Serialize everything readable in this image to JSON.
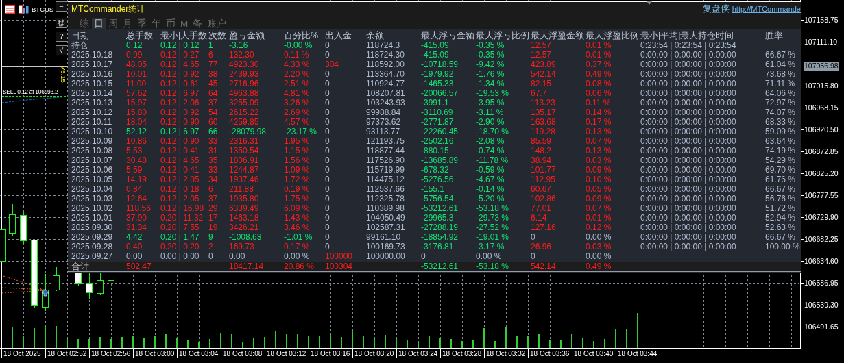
{
  "symbol": "BTCUS",
  "side_buttons": [
    "−",
    "移",
    "?",
    "√"
  ],
  "version": "V5.15",
  "order_label": "SELL 0.12 at 106993.2",
  "panel": {
    "title": "MTCommander统计",
    "brand": "复盘侠",
    "link": "http://MTCommande",
    "tabs": [
      {
        "label": "综",
        "selected": false
      },
      {
        "label": "日",
        "selected": true
      },
      {
        "label": "周",
        "selected": false
      },
      {
        "label": "月",
        "selected": false
      },
      {
        "label": "季",
        "selected": false
      },
      {
        "label": "年",
        "selected": false
      },
      {
        "label": "币",
        "selected": false
      },
      {
        "label": "M",
        "selected": false
      },
      {
        "label": "备",
        "selected": false
      },
      {
        "label": "账户",
        "selected": false
      }
    ],
    "columns": [
      {
        "title": "日期",
        "kind": "date"
      },
      {
        "title": "总手数",
        "kind": "result"
      },
      {
        "title": "最小|大手数",
        "kind": "result"
      },
      {
        "title": "次数",
        "kind": "result"
      },
      {
        "title": "盈亏金额",
        "kind": "result"
      },
      {
        "title": "百分比%",
        "kind": "result"
      },
      {
        "title": "出入金",
        "kind": "deposit"
      },
      {
        "title": "余额",
        "kind": "neutral"
      },
      {
        "title": "最大浮亏金额",
        "kind": "loss"
      },
      {
        "title": "最大浮亏比例",
        "kind": "loss"
      },
      {
        "title": "最大浮盈金额",
        "kind": "gain"
      },
      {
        "title": "最大浮盈比例",
        "kind": "gain"
      },
      {
        "title": "最小|平均|最大持仓时间",
        "kind": "neutral"
      },
      {
        "title": "胜率",
        "kind": "neutral"
      }
    ],
    "rows": [
      {
        "kind": "loss",
        "cells": [
          "持仓",
          "0.12",
          "0.12 | 0.12",
          "1",
          "-3.16",
          "-0.00 %",
          "0",
          "118724.3",
          "-415.09",
          "-0.35 %",
          "12.57",
          "0.01 %",
          "0:23:54 | 0:23:54 | 0:23:54",
          null
        ]
      },
      {
        "kind": "profit",
        "cells": [
          "2025.10.18",
          "0.99",
          "0.12 | 0.27",
          "6",
          "132.30",
          "0.11 %",
          "0",
          "118724.30",
          "-415.09",
          "-0.35 %",
          "12.57",
          "0.01 %",
          "0:00:00 | 0:00:00 | 0:00:00",
          "66.67 %"
        ]
      },
      {
        "kind": "profit",
        "cells": [
          "2025.10.17",
          "48.05",
          "0.12 | 4.65",
          "77",
          "4923.30",
          "4.33 %",
          "304",
          "118592.00",
          "-10718.59",
          "-9.42 %",
          "423.89",
          "0.37 %",
          "0:00:00 | 0:00:00 | 0:00:00",
          "61.04 %"
        ]
      },
      {
        "kind": "profit",
        "cells": [
          "2025.10.16",
          "10.01",
          "0.12 | 0.92",
          "38",
          "2439.93",
          "2.20 %",
          "0",
          "113364.70",
          "-1979.92",
          "-1.76 %",
          "542.14",
          "0.49 %",
          "0:00:00 | 0:00:00 | 0:00:00",
          "73.68 %"
        ]
      },
      {
        "kind": "profit",
        "cells": [
          "2025.10.15",
          "11.00",
          "0.12 | 0.61",
          "45",
          "2716.96",
          "2.51 %",
          "0",
          "110924.77",
          "-1465.33",
          "-1.34 %",
          "82.15",
          "0.08 %",
          "0:00:00 | 0:00:00 | 0:00:00",
          "71.11 %"
        ]
      },
      {
        "kind": "profit",
        "cells": [
          "2025.10.14",
          "57.62",
          "0.12 | 6.97",
          "64",
          "4963.88",
          "4.81 %",
          "0",
          "108207.81",
          "-20066.57",
          "-19.53 %",
          "67.7",
          "0.06 %",
          "0:00:00 | 0:00:00 | 0:00:00",
          "64.06 %"
        ]
      },
      {
        "kind": "profit",
        "cells": [
          "2025.10.13",
          "15.97",
          "0.12 | 2.06",
          "37",
          "3255.09",
          "3.26 %",
          "0",
          "103243.93",
          "-3991.1",
          "-3.95 %",
          "113.23",
          "0.11 %",
          "0:00:00 | 0:00:00 | 0:00:00",
          "72.97 %"
        ]
      },
      {
        "kind": "profit",
        "cells": [
          "2025.10.12",
          "15.80",
          "0.12 | 0.92",
          "54",
          "2615.22",
          "2.69 %",
          "0",
          "99988.84",
          "-3110.69",
          "-3.11 %",
          "135.17",
          "0.14 %",
          "0:00:00 | 0:00:00 | 0:00:00",
          "74.07 %"
        ]
      },
      {
        "kind": "profit",
        "cells": [
          "2025.10.11",
          "18.04",
          "0.12 | 0.90",
          "60",
          "4259.85",
          "4.57 %",
          "0",
          "97373.62",
          "-2771.87",
          "-2.90 %",
          "163.68",
          "0.17 %",
          "0:00:00 | 0:00:00 | 0:00:00",
          "68.33 %"
        ]
      },
      {
        "kind": "loss",
        "cells": [
          "2025.10.10",
          "52.12",
          "0.12 | 6.97",
          "66",
          "-28079.98",
          "-23.17 %",
          "0",
          "93113.77",
          "-22260.45",
          "-18.70 %",
          "119.28",
          "0.13 %",
          "0:00:00 | 0:00:00 | 0:00:00",
          "59.09 %"
        ]
      },
      {
        "kind": "profit",
        "cells": [
          "2025.10.09",
          "10.86",
          "0.12 | 0.90",
          "33",
          "2316.31",
          "1.95 %",
          "0",
          "121193.75",
          "-2502.16",
          "-2.08 %",
          "85.59",
          "0.07 %",
          "0:00:00 | 0:00:00 | 0:00:00",
          "63.64 %"
        ]
      },
      {
        "kind": "profit",
        "cells": [
          "2025.10.08",
          "5.53",
          "0.12 | 0.41",
          "31",
          "1350.54",
          "1.15 %",
          "0",
          "118877.44",
          "-880.15",
          "-0.74 %",
          "148.2",
          "0.13 %",
          "0:00:00 | 0:00:00 | 0:00:00",
          "74.19 %"
        ]
      },
      {
        "kind": "profit",
        "cells": [
          "2025.10.07",
          "30.48",
          "0.12 | 4.65",
          "35",
          "1806.91",
          "1.56 %",
          "0",
          "117526.90",
          "-13685.89",
          "-11.78 %",
          "38.94",
          "0.03 %",
          "0:00:00 | 0:00:00 | 0:00:00",
          "54.29 %"
        ]
      },
      {
        "kind": "profit",
        "cells": [
          "2025.10.06",
          "5.59",
          "0.12 | 0.41",
          "33",
          "1244.87",
          "1.09 %",
          "0",
          "115719.99",
          "-678.32",
          "-0.59 %",
          "101.77",
          "0.09 %",
          "0:00:00 | 0:00:00 | 0:00:00",
          "69.70 %"
        ]
      },
      {
        "kind": "profit",
        "cells": [
          "2025.10.05",
          "14.19",
          "0.12 | 2.05",
          "34",
          "1937.46",
          "1.72 %",
          "0",
          "114475.12",
          "-5276.56",
          "-4.67 %",
          "112.95",
          "0.10 %",
          "0:00:00 | 0:00:00 | 0:00:00",
          "61.76 %"
        ]
      },
      {
        "kind": "profit",
        "cells": [
          "2025.10.04",
          "0.84",
          "0.12 | 0.18",
          "6",
          "211.88",
          "0.19 %",
          "0",
          "112537.66",
          "-155.1",
          "-0.14 %",
          "60.67",
          "0.05 %",
          "0:00:00 | 0:00:00 | 0:00:00",
          "66.67 %"
        ]
      },
      {
        "kind": "profit",
        "cells": [
          "2025.10.03",
          "12.64",
          "0.12 | 2.05",
          "37",
          "1935.80",
          "1.75 %",
          "0",
          "112325.78",
          "-5756.54",
          "-5.20 %",
          "102.86",
          "0.09 %",
          "0:00:00 | 0:00:00 | 0:00:00",
          "56.76 %"
        ]
      },
      {
        "kind": "profit",
        "cells": [
          "2025.10.02",
          "118.56",
          "0.12 | 16.98",
          "29",
          "6339.49",
          "6.09 %",
          "0",
          "110389.98",
          "-53212.61",
          "-53.18 %",
          "77.01",
          "0.07 %",
          "0:00:00 | 0:00:00 | 0:00:00",
          "51.72 %"
        ]
      },
      {
        "kind": "profit",
        "cells": [
          "2025.10.01",
          "37.90",
          "0.20 | 11.32",
          "17",
          "1463.18",
          "1.43 %",
          "0",
          "104050.49",
          "-29965.3",
          "-29.73 %",
          "6.14",
          "0.01 %",
          "0:00:00 | 0:00:00 | 0:00:00",
          "52.94 %"
        ]
      },
      {
        "kind": "profit",
        "cells": [
          "2025.09.30",
          "31.34",
          "0.20 | 7.55",
          "19",
          "3426.21",
          "3.46 %",
          "0",
          "102587.31",
          "-27288.19",
          "-27.52 %",
          "127.16",
          "0.12 %",
          "0:00:00 | 0:00:00 | 0:00:00",
          "52.63 %"
        ]
      },
      {
        "kind": "loss",
        "cells": [
          "2025.09.29",
          "4.42",
          "0.20 | 1.47",
          "9",
          "-1008.63",
          "-1.01 %",
          "0",
          "99161.10",
          "-18854.92",
          "-19.01 %",
          "0",
          "0.00 %",
          "0:00:00 | 0:00:00 | 0:00:00",
          "66.67 %"
        ]
      },
      {
        "kind": "profit",
        "cells": [
          "2025.09.28",
          "0.40",
          "0.20 | 0.20",
          "2",
          "169.73",
          "0.17 %",
          "0",
          "100169.73",
          "-3176.81",
          "-3.17 %",
          "26.96",
          "0.03 %",
          "0:00:00 | 0:00:00 | 0:00:00",
          "100.00 %"
        ]
      },
      {
        "kind": "flat",
        "cells": [
          "2025.09.27",
          "0.00",
          "0.00 | 0.00",
          "0",
          "0.00",
          "0.00 %",
          "100000",
          "100000.00",
          "0",
          "0.00 %",
          "0",
          "0.00 %",
          null,
          null
        ]
      }
    ],
    "total": {
      "kind": "profit",
      "cells": [
        "合计",
        "502.47",
        null,
        null,
        "18417.14",
        "20.86 %",
        "100304",
        null,
        "-53212.61",
        "-53.18 %",
        "542.14",
        "0.49 %",
        null,
        null
      ]
    }
  },
  "price_axis": [
    {
      "label": "107158.75",
      "kind": "tick"
    },
    {
      "label": "107111.10",
      "kind": "tick"
    },
    {
      "label": "107056.98",
      "kind": "current"
    },
    {
      "label": "107015.80",
      "kind": "tick"
    },
    {
      "label": "106968.15",
      "kind": "tick"
    },
    {
      "label": "106920.50",
      "kind": "tick"
    },
    {
      "label": "106872.85",
      "kind": "tick"
    },
    {
      "label": "106825.20",
      "kind": "tick"
    },
    {
      "label": "106777.55",
      "kind": "tick"
    },
    {
      "label": "106729.90",
      "kind": "tick"
    },
    {
      "label": "106682.25",
      "kind": "tick"
    },
    {
      "label": "106634.60",
      "kind": "tick"
    },
    {
      "label": "106586.95",
      "kind": "tick"
    },
    {
      "label": "106539.30",
      "kind": "tick"
    },
    {
      "label": "106491.65",
      "kind": "tick"
    }
  ],
  "time_axis": [
    "18 Oct 2025",
    "18 Oct 02:52",
    "18 Oct 02:56",
    "18 Oct 03:00",
    "18 Oct 03:04",
    "18 Oct 03:08",
    "18 Oct 03:12",
    "18 Oct 03:16",
    "18 Oct 03:20",
    "18 Oct 03:24",
    "18 Oct 03:28",
    "18 Oct 03:32",
    "18 Oct 03:36",
    "18 Oct 03:40",
    "18 Oct 03:44"
  ]
}
